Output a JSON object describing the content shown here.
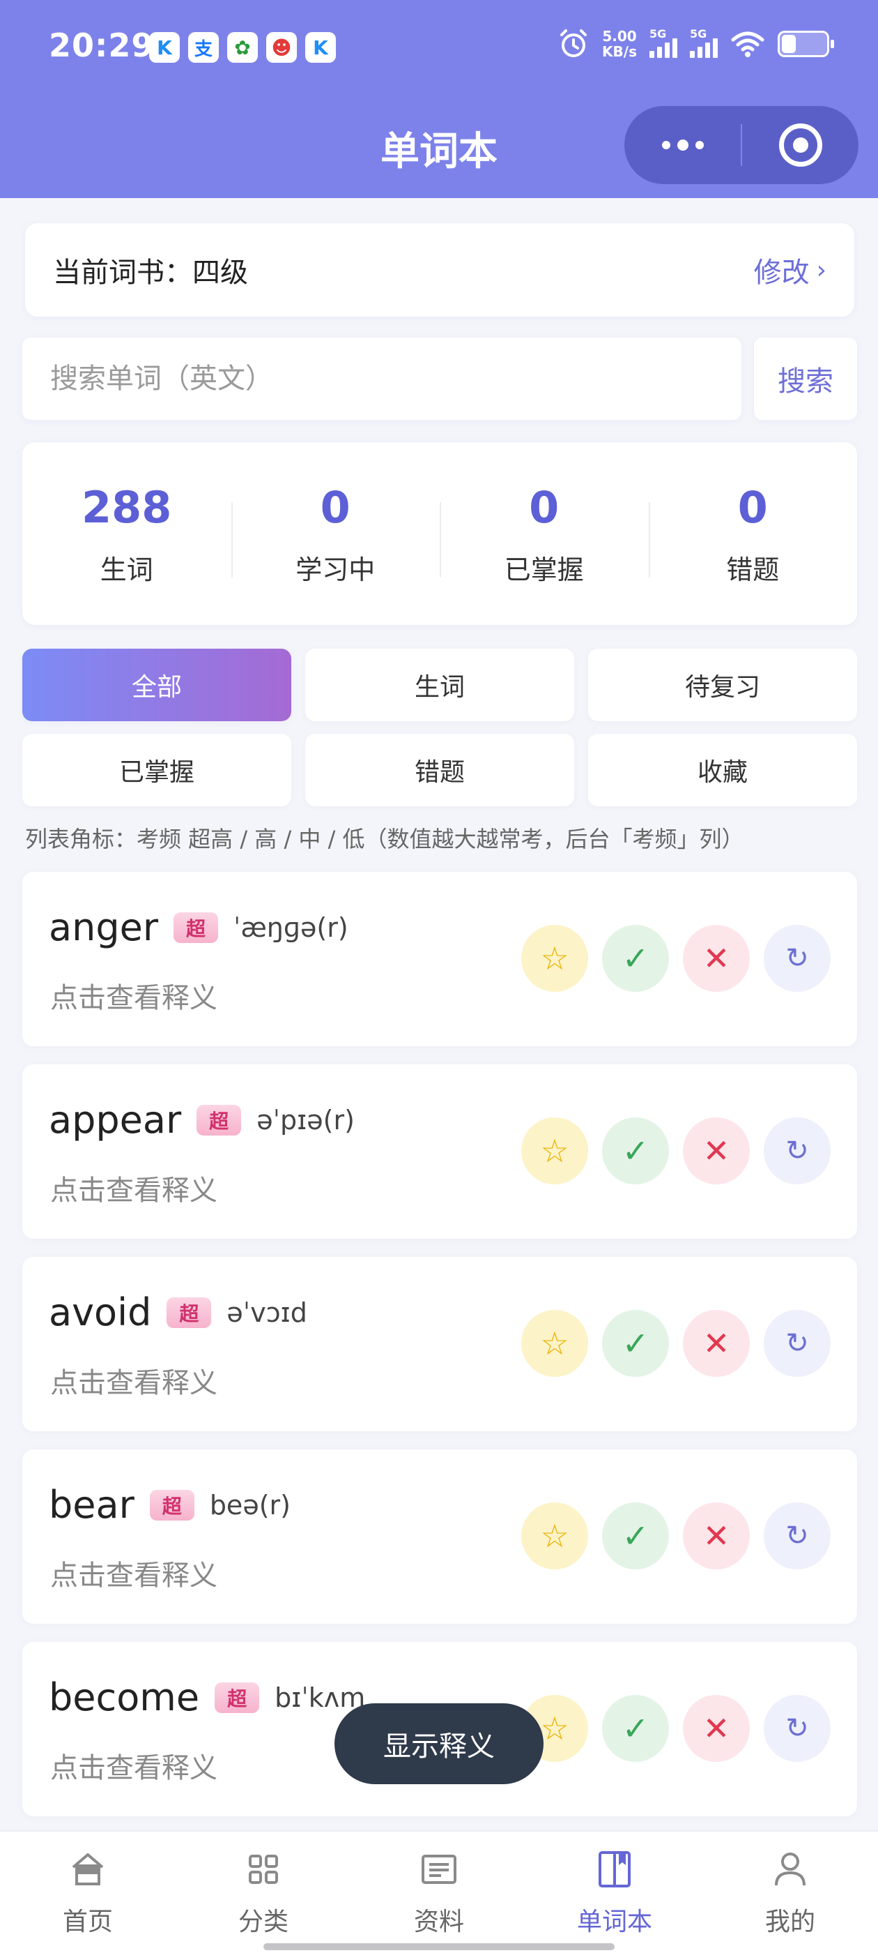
{
  "status_bar": {
    "time": "20:29",
    "app_icons": [
      {
        "name": "kugou-icon",
        "glyph": "K",
        "color": "#1e8ef5"
      },
      {
        "name": "alipay-icon",
        "glyph": "支",
        "color": "#1677ff"
      },
      {
        "name": "green-app-icon",
        "glyph": "✿",
        "color": "#2c9b3a"
      },
      {
        "name": "clown-app-icon",
        "glyph": "☻",
        "color": "#e33a3a"
      },
      {
        "name": "kugou-icon-2",
        "glyph": "K",
        "color": "#1e8ef5"
      }
    ],
    "net_speed_value": "5.00",
    "net_speed_unit": "KB/s",
    "signal_1_label": "5G",
    "signal_2_label": "5G"
  },
  "header": {
    "title": "单词本"
  },
  "book": {
    "label": "当前词书：四级",
    "edit_label": "修改",
    "edit_chevron": "›"
  },
  "search": {
    "placeholder": "搜索单词（英文）",
    "value": "",
    "button_label": "搜索"
  },
  "stats": [
    {
      "value": "288",
      "label": "生词"
    },
    {
      "value": "0",
      "label": "学习中"
    },
    {
      "value": "0",
      "label": "已掌握"
    },
    {
      "value": "0",
      "label": "错题"
    }
  ],
  "filter_tabs": [
    {
      "label": "全部",
      "active": true
    },
    {
      "label": "生词",
      "active": false
    },
    {
      "label": "待复习",
      "active": false
    },
    {
      "label": "已掌握",
      "active": false
    },
    {
      "label": "错题",
      "active": false
    },
    {
      "label": "收藏",
      "active": false
    }
  ],
  "legend_note": "列表角标：考频 超高 / 高 / 中 / 低（数值越大越常考，后台「考频」列）",
  "words": [
    {
      "word": "anger",
      "badge": "超",
      "phonetic": "ˈæŋɡə(r)",
      "hint": "点击查看释义"
    },
    {
      "word": "appear",
      "badge": "超",
      "phonetic": "əˈpɪə(r)",
      "hint": "点击查看释义"
    },
    {
      "word": "avoid",
      "badge": "超",
      "phonetic": "əˈvɔɪd",
      "hint": "点击查看释义"
    },
    {
      "word": "bear",
      "badge": "超",
      "phonetic": "beə(r)",
      "hint": "点击查看释义"
    },
    {
      "word": "become",
      "badge": "超",
      "phonetic": "bɪˈkʌm",
      "hint": "点击查看释义"
    }
  ],
  "word_actions": {
    "star": "☆",
    "check": "✓",
    "cross": "✕",
    "review": "↻"
  },
  "toast": {
    "label": "显示释义"
  },
  "bottom_nav": [
    {
      "label": "首页",
      "icon": "home-icon",
      "active": false
    },
    {
      "label": "分类",
      "icon": "grid-icon",
      "active": false
    },
    {
      "label": "资料",
      "icon": "document-icon",
      "active": false
    },
    {
      "label": "单词本",
      "icon": "book-icon",
      "active": true
    },
    {
      "label": "我的",
      "icon": "user-icon",
      "active": false
    }
  ],
  "colors": {
    "header_bg": "#7d82ea",
    "accent": "#6466d6",
    "badge_text": "#d0326b"
  }
}
